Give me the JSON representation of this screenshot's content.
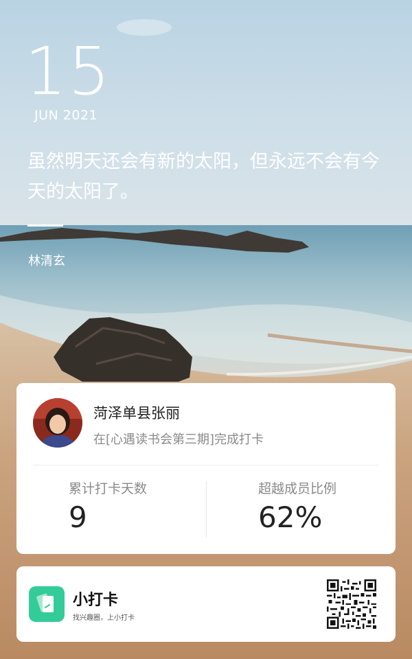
{
  "date": {
    "day": "15",
    "month_year": "JUN 2021"
  },
  "quote": {
    "text": "虽然明天还会有新的太阳，但永远不会有今天的太阳了。",
    "author": "林清玄"
  },
  "checkin": {
    "user_name": "菏泽单县张丽",
    "description": "在[心遇读书会第三期]完成打卡",
    "stats": [
      {
        "label": "累计打卡天数",
        "value": "9"
      },
      {
        "label": "超越成员比例",
        "value": "62%"
      }
    ]
  },
  "brand": {
    "name": "小打卡",
    "slogan": "找兴趣圈，上小打卡"
  },
  "colors": {
    "brand_green": "#33cc99",
    "card_bg": "#ffffff",
    "text_gray": "#8a8a8a"
  },
  "icons": {
    "app_logo": "note-card-icon",
    "qr_code": "qr-code-icon",
    "avatar": "user-avatar"
  }
}
